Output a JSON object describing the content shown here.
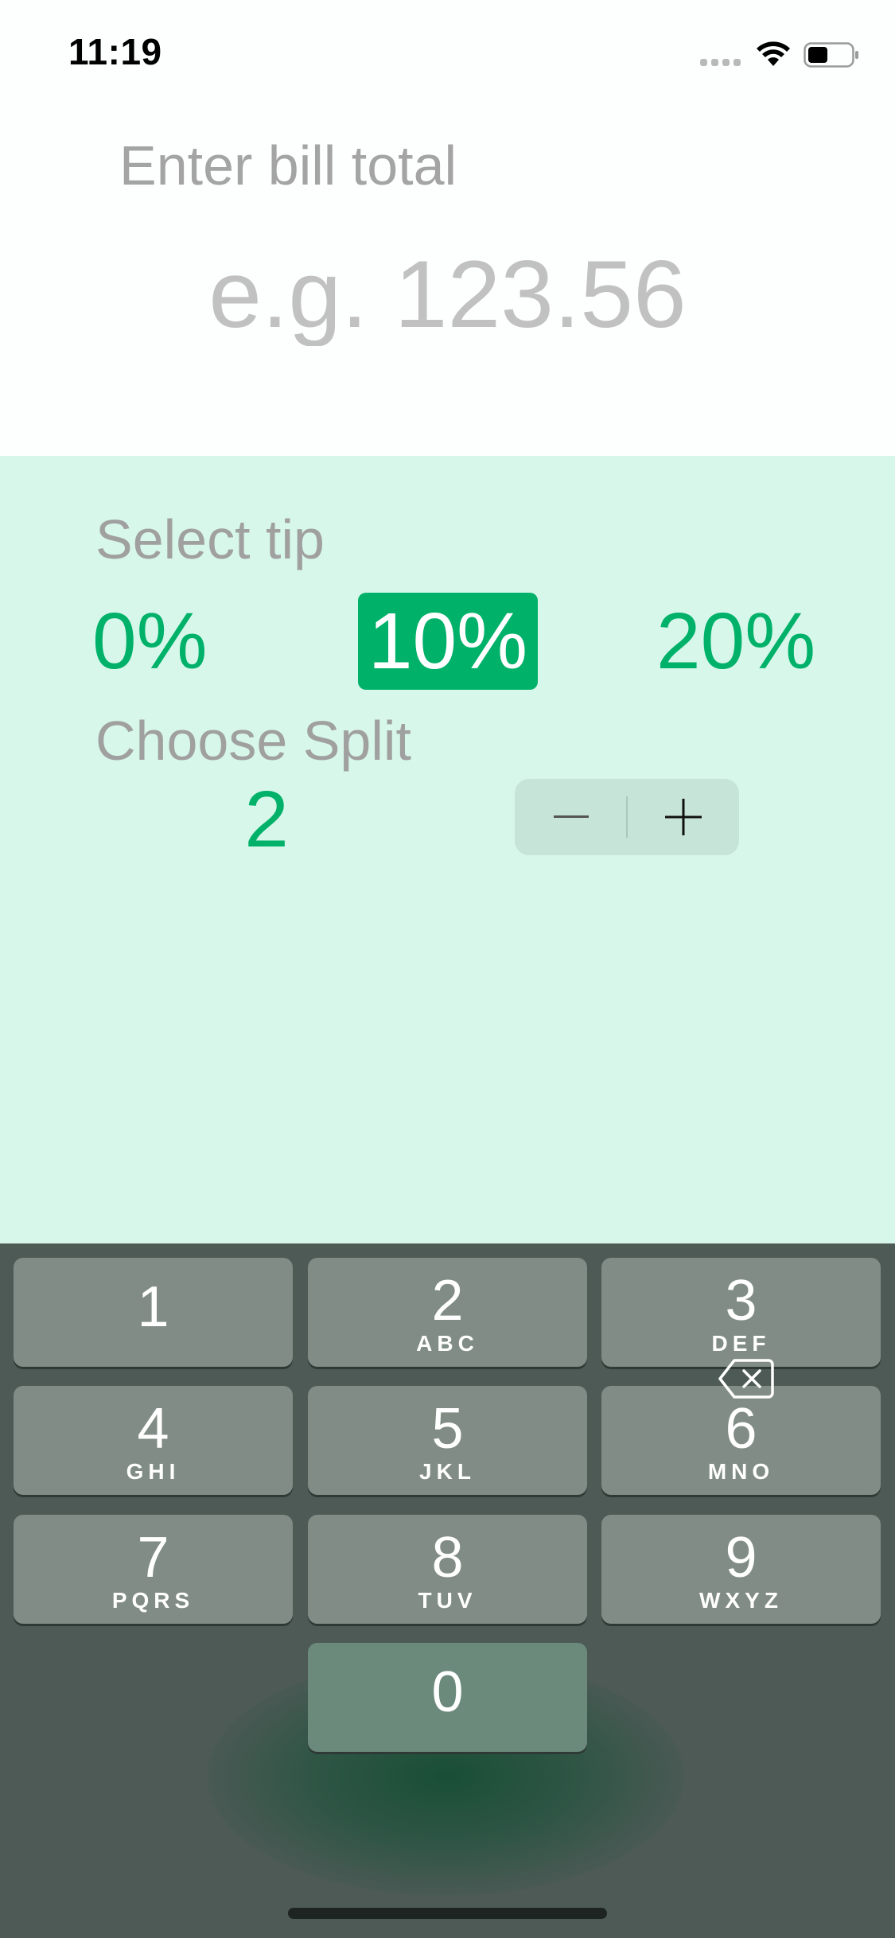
{
  "status_bar": {
    "time": "11:19",
    "icons": [
      "cellular-signal-icon",
      "wifi-icon",
      "battery-icon"
    ]
  },
  "bill": {
    "label": "Enter bill total",
    "placeholder": "e.g. 123.56",
    "value": ""
  },
  "tip": {
    "label": "Select tip",
    "options": [
      "0%",
      "10%",
      "20%"
    ],
    "selected": "10%"
  },
  "split": {
    "label": "Choose Split",
    "value": "2",
    "decrement_icon": "minus-icon",
    "increment_icon": "plus-icon"
  },
  "keypad": {
    "keys": [
      {
        "num": "1",
        "letters": ""
      },
      {
        "num": "2",
        "letters": "ABC"
      },
      {
        "num": "3",
        "letters": "DEF"
      },
      {
        "num": "4",
        "letters": "GHI"
      },
      {
        "num": "5",
        "letters": "JKL"
      },
      {
        "num": "6",
        "letters": "MNO"
      },
      {
        "num": "7",
        "letters": "PQRS"
      },
      {
        "num": "8",
        "letters": "TUV"
      },
      {
        "num": "9",
        "letters": "WXYZ"
      },
      {
        "num": "0",
        "letters": ""
      }
    ],
    "delete_icon": "backspace-icon"
  },
  "colors": {
    "accent": "#00b16a",
    "tip_background": "#d7f7ea",
    "keyboard_background": "#4d5a56",
    "key_background": "#808c85"
  }
}
